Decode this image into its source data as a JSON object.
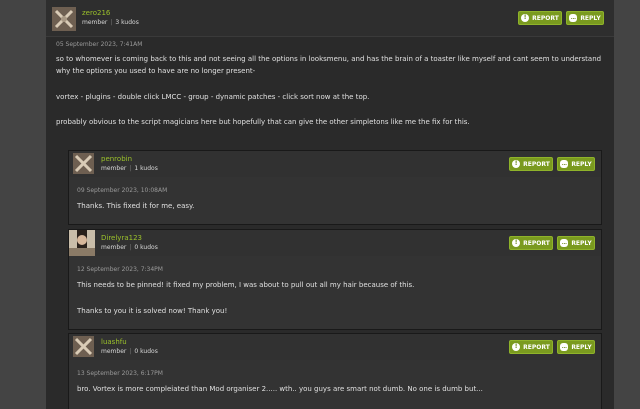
{
  "main_post": {
    "author": "zero216",
    "role": "member",
    "kudos": "3 kudos",
    "date": "05 September 2023, 7:41AM",
    "paragraphs": [
      "so to whomever is coming back to this and not seeing all the options in looksmenu, and has the brain of a toaster like myself and cant seem to understand why the options you used to have are no longer present-",
      "vortex - plugins - double click LMCC - group - dynamic patches - click sort now at the top.",
      "probably obvious to the script magicians here but hopefully that can give the other simpletons like me the fix for this."
    ]
  },
  "buttons": {
    "report": "REPORT",
    "reply": "REPLY"
  },
  "replies": [
    {
      "author": "penrobin",
      "role": "member",
      "kudos": "1 kudos",
      "date": "09 September 2023, 10:08AM",
      "paragraphs": [
        "Thanks. This fixed it for me, easy."
      ]
    },
    {
      "author": "Direlyra123",
      "role": "member",
      "kudos": "0 kudos",
      "date": "12 September 2023, 7:34PM",
      "paragraphs": [
        "This needs to be pinned! it fixed my problem, I was about to pull out all my hair because of this.",
        "Thanks to you it is solved now! Thank you!"
      ]
    },
    {
      "author": "luashfu",
      "role": "member",
      "kudos": "0 kudos",
      "date": "13 September 2023, 6:17PM",
      "paragraphs": [
        "bro. Vortex is more compleiated than Mod organiser 2..... wth.. you guys are smart not dumb. No one is dumb but..."
      ]
    }
  ],
  "icons": {
    "report": "exclamation-icon",
    "reply": "speech-bubble-icon"
  },
  "colors": {
    "accent": "#9bc12b",
    "button": "#7a9a1f",
    "background": "#2a2a2a"
  }
}
